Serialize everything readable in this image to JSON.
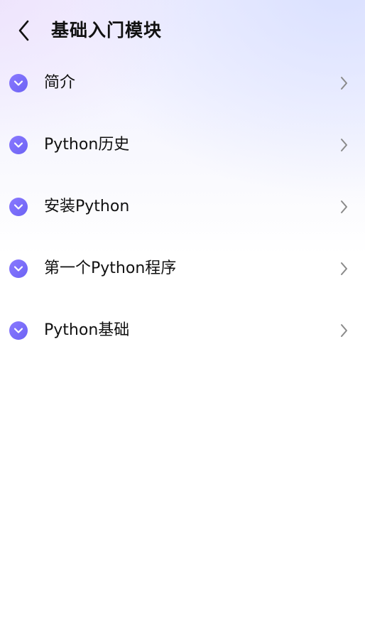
{
  "header": {
    "title": "基础入门模块"
  },
  "list": {
    "items": [
      {
        "label": "简介"
      },
      {
        "label": "Python历史"
      },
      {
        "label": "安装Python"
      },
      {
        "label": "第一个Python程序"
      },
      {
        "label": "Python基础"
      }
    ]
  },
  "colors": {
    "accent": "#7b6ffa",
    "chevron": "#8a8a8a"
  },
  "icons": {
    "back": "chevron-left-icon",
    "item": "expand-circle-icon",
    "arrow": "chevron-right-icon"
  }
}
